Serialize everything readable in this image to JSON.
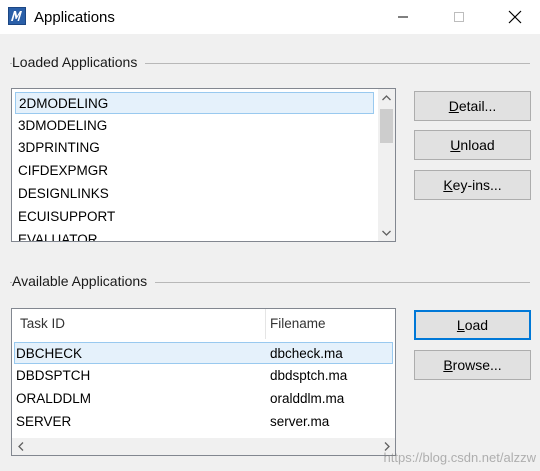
{
  "window": {
    "title": "Applications"
  },
  "loaded": {
    "group_label": "Loaded Applications",
    "items": [
      "2DMODELING",
      "3DMODELING",
      "3DPRINTING",
      "CIFDEXPMGR",
      "DESIGNLINKS",
      "ECUISUPPORT",
      "EVALUATOR"
    ],
    "selected_index": 0
  },
  "loaded_buttons": {
    "detail": {
      "pre": "",
      "key": "D",
      "post": "etail..."
    },
    "unload": {
      "pre": "",
      "key": "U",
      "post": "nload"
    },
    "keyins": {
      "pre": "",
      "key": "K",
      "post": "ey-ins..."
    }
  },
  "available": {
    "group_label": "Available Applications",
    "columns": [
      "Task ID",
      "Filename"
    ],
    "rows": [
      {
        "task_id": "DBCHECK",
        "filename": "dbcheck.ma"
      },
      {
        "task_id": "DBDSPTCH",
        "filename": "dbdsptch.ma"
      },
      {
        "task_id": "ORALDDLM",
        "filename": "oralddlm.ma"
      },
      {
        "task_id": "SERVER",
        "filename": "server.ma"
      }
    ],
    "selected_index": 0
  },
  "available_buttons": {
    "load": {
      "pre": "",
      "key": "L",
      "post": "oad"
    },
    "browse": {
      "pre": "",
      "key": "B",
      "post": "rowse..."
    }
  },
  "watermark": "https://blog.csdn.net/alzzw"
}
